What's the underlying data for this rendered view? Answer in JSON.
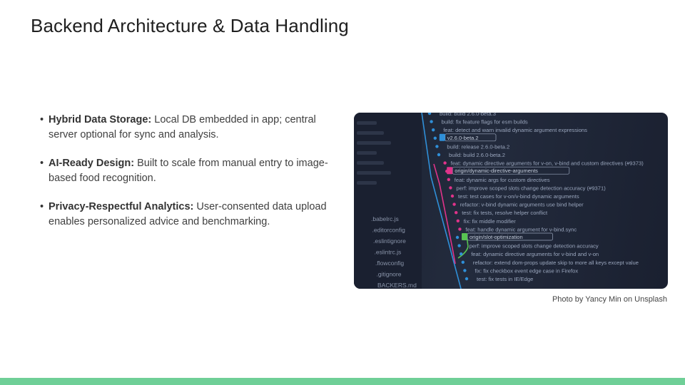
{
  "slide": {
    "title": "Backend Architecture & Data Handling",
    "bullets": [
      {
        "lead": "Hybrid Data Storage:",
        "text": " Local DB embedded in app; central server optional for sync and analysis."
      },
      {
        "lead": "AI-Ready Design:",
        "text": " Built to scale from manual entry to image-based food recognition."
      },
      {
        "lead": "Privacy-Respectful Analytics:",
        "text": " User-consented data upload enables personalized advice and benchmarking."
      }
    ],
    "bullet_glyph": "•",
    "photo_caption": "Photo by Yancy Min on Unsplash"
  },
  "photo": {
    "file_tree": [
      ".babelrc.js",
      ".editorconfig",
      ".eslintignore",
      ".eslintrc.js",
      ".flowconfig",
      ".gitignore",
      "BACKERS.md"
    ],
    "commit_lines": [
      "build: build 2.6.0-beta.3",
      "build: fix feature flags for esm builds",
      "feat: detect and warn invalid dynamic argument expressions",
      "v2.6.0-beta.2",
      "build: release 2.6.0-beta.2",
      "build: build 2.6.0-beta.2",
      "feat: dynamic directive arguments for v-on, v-bind and custom directives (#9373)",
      "origin/dynamic-directive-arguments",
      "feat: dynamic args for custom directives",
      "perf: improve scoped slots change detection accuracy (#9371)",
      "test: test cases for v-on/v-bind dynamic arguments",
      "refactor: v-bind dynamic arguments use bind helper",
      "test: fix tests, resolve helper conflict",
      "fix: fix middle modifier",
      "feat: handle dynamic argument for v-bind.sync",
      "origin/slot-optimization",
      "perf: improve scoped slots change detection accuracy",
      "feat: dynamic directive arguments for v-bind and v-on",
      "refactor: extend dom-props update skip to more all keys except value",
      "fix: fix checkbox event edge case in Firefox",
      "test: fix tests in IE/Edge"
    ],
    "colors": {
      "background": "#1f2637",
      "branch_blue": "#2f8fd8",
      "branch_pink": "#e0338a",
      "branch_green": "#58c452",
      "text": "#9aa6bd"
    }
  },
  "theme": {
    "accent_bar": "#6fcf97"
  }
}
